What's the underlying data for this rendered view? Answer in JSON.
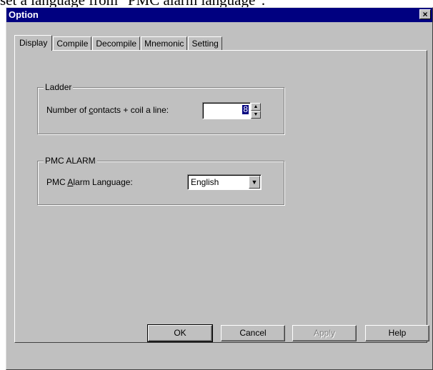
{
  "document": {
    "text": "set a language from \"PMC alarm language\"."
  },
  "window": {
    "title": "Option",
    "close_glyph": "×"
  },
  "tabs": [
    {
      "label": "Display",
      "active": true
    },
    {
      "label": "Compile"
    },
    {
      "label": "Decompile"
    },
    {
      "label": "Mnemonic"
    },
    {
      "label": "Setting"
    }
  ],
  "ladder": {
    "group_title": "Ladder",
    "contacts_label_pre": "Number of ",
    "contacts_label_key": "c",
    "contacts_label_post": "ontacts + coil a line:",
    "contacts_value": "8",
    "spin_up_icon": "▲",
    "spin_down_icon": "▼"
  },
  "pmc_alarm": {
    "group_title": "PMC ALARM",
    "language_label_pre": "PMC ",
    "language_label_key": "A",
    "language_label_post": "larm Language:",
    "language_value": "English",
    "dropdown_icon": "▼"
  },
  "buttons": {
    "ok": "OK",
    "cancel": "Cancel",
    "apply": "Apply",
    "help": "Help"
  }
}
